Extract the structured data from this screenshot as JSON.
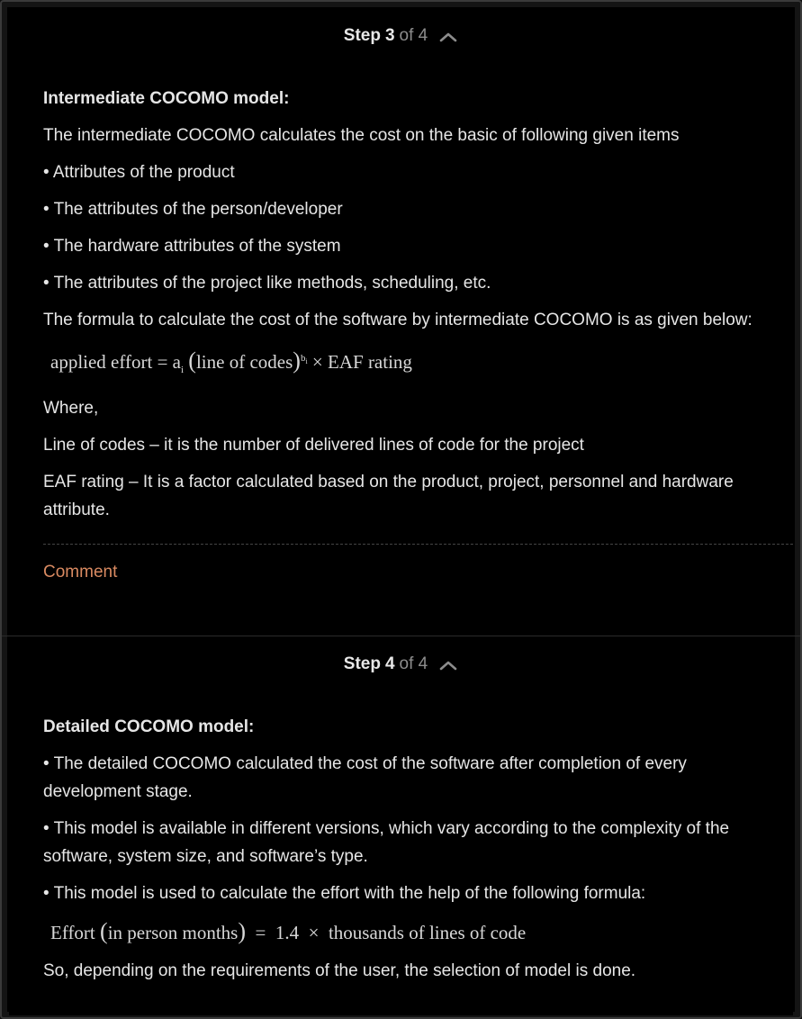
{
  "steps": [
    {
      "word": "Step",
      "number": "3",
      "of_total": "of 4",
      "heading": "Intermediate COCOMO model:",
      "intro": "The intermediate COCOMO calculates the cost on the basic of following given items",
      "bullets": [
        "• Attributes of the product",
        "• The attributes of the person/developer",
        "• The hardware attributes of the system",
        "• The attributes of the project like methods, scheduling, etc."
      ],
      "formula_intro": "The formula to calculate the cost of the software by intermediate COCOMO is as given below:",
      "formula": {
        "lhs": "applied effort = a",
        "a_sub": "i",
        "lparen": "(",
        "mid": "line of codes",
        "rparen": ")",
        "b_sup": "b",
        "b_sub": "i",
        "rhs": " × EAF rating"
      },
      "where": "Where,",
      "def1": "Line of codes – it is the number of delivered lines of code for the project",
      "def2": "EAF rating – It is a factor calculated based on the product, project, personnel and hardware attribute.",
      "comment": "Comment"
    },
    {
      "word": "Step",
      "number": "4",
      "of_total": "of 4",
      "heading": "Detailed COCOMO model:",
      "bullets": [
        "• The detailed COCOMO calculated the cost of the software after completion of every development stage.",
        "• This model is available in different versions, which vary according to the complexity of the software, system size, and software’s type.",
        "• This model is used to calculate the effort with the help of the following formula:"
      ],
      "formula": {
        "lhs": "Effort ",
        "lparen": "(",
        "mid": "in person months",
        "rparen": ")",
        "rhs": "  =  1.4  ×  thousands of lines of code"
      },
      "conclusion": "So, depending on the requirements of the user, the selection of model is done."
    }
  ],
  "colors": {
    "background": "#000000",
    "text": "#e6e6e6",
    "muted": "#8c8c8c",
    "link": "#d98a61"
  },
  "icons": {
    "collapse": "chevron-up-icon"
  }
}
